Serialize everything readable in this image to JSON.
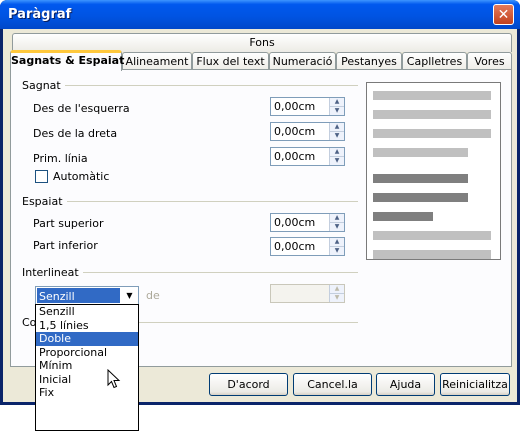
{
  "window": {
    "title": "Paràgraf"
  },
  "tabs": {
    "top_row": [
      "Fons"
    ],
    "bottom_row": [
      "Sagnats & Espaiat",
      "Alineament",
      "Flux del text",
      "Numeració",
      "Pestanyes",
      "Caplletres",
      "Vores"
    ],
    "active": "Sagnats & Espaiat"
  },
  "indent": {
    "title": "Sagnat",
    "before_label": "Des de l'esquerra",
    "before_value": "0,00cm",
    "after_label": "Des de la dreta",
    "after_value": "0,00cm",
    "first_line_label": "Prim. línia",
    "first_line_value": "0,00cm",
    "automatic_label": "Automàtic",
    "automatic_checked": false
  },
  "spacing": {
    "title": "Espaiat",
    "above_label": "Part superior",
    "above_value": "0,00cm",
    "below_label": "Part inferior",
    "below_value": "0,00cm"
  },
  "line_spacing": {
    "title": "Interlineat",
    "selected": "Senzill",
    "of_label": "de",
    "of_value": "",
    "options": [
      "Senzill",
      "1,5 línies",
      "Doble",
      "Proporcional",
      "Mínim",
      "Inicial",
      "Fix"
    ],
    "highlighted": "Doble"
  },
  "register": {
    "title_partial": "Co"
  },
  "buttons": {
    "ok": "D'acord",
    "cancel": "Cancel.la",
    "help": "Ajuda",
    "reset": "Reinicialitza"
  },
  "colors": {
    "highlight": "#316ac5",
    "dialog_bg": "#ece9d8",
    "title_bar": "#0054e3",
    "preview_active": "#7f7f7f",
    "preview_other": "#c0c0c0"
  }
}
